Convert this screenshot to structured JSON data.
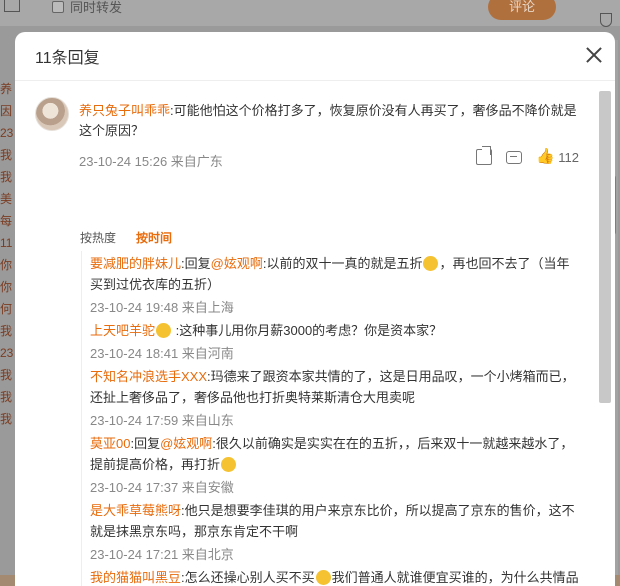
{
  "background": {
    "repost_checkbox_label": "同时转发",
    "comment_button_label": "评论",
    "left_column_chars": [
      "养",
      "因",
      "23",
      "我",
      "我",
      "美",
      "每",
      "11",
      "你",
      "你",
      "何",
      "我",
      "23",
      "我",
      "我",
      "我"
    ]
  },
  "modal": {
    "title": "11条回复",
    "root_comment": {
      "username": "养只兔子叫乖乖",
      "text": ":可能他怕这个价格打多了，恢复原价没有人再买了，奢侈品不降价就是这个原因？",
      "meta": "23-10-24 15:26 来自广东",
      "like_count": "112"
    },
    "sort_options": [
      "按热度",
      "按时间"
    ],
    "replies": [
      {
        "username": "要减肥的胖妹儿",
        "body_a": ":回复",
        "mention": "@妶观啊",
        "body_b": ":以前的双十一真的就是五折",
        "emoji": true,
        "body_c": "，再也回不去了（当年买到过优衣库的五折）",
        "time": "23-10-24 19:48 来自上海"
      },
      {
        "username": "上天吧羊驼",
        "body_a": " ",
        "mention": "",
        "body_b": ":这种事儿用你月薪3000的考虑？你是资本家？",
        "emoji": false,
        "body_c": "",
        "time": "23-10-24 18:41 来自河南",
        "badge_emoji": true
      },
      {
        "username": "不知名冲浪选手XXX",
        "body_a": ":玛德来了跟资本家共情的了，这是日用品叹，一个小烤箱而已，还扯上奢侈品了，奢侈品他也打折奥特莱斯清仓大甩卖呢",
        "mention": "",
        "body_b": "",
        "emoji": false,
        "body_c": "",
        "time": "23-10-24 17:59 来自山东"
      },
      {
        "username": "莫亚00",
        "body_a": ":回复",
        "mention": "@妶观啊",
        "body_b": ":很久以前确实是实实在在的五折，，后来双十一就越来越水了，提前提高价格，再打折",
        "emoji": true,
        "body_c": "",
        "time": "23-10-24 17:37 来自安徽"
      },
      {
        "username": "是大乖草莓熊呀",
        "body_a": ":他只是想要李佳琪的用户来京东比价，所以提高了京东的售价，这不就是抹黑京东吗，那京东肯定不干啊",
        "mention": "",
        "body_b": "",
        "emoji": false,
        "body_c": "",
        "time": "23-10-24 17:21 来自北京"
      },
      {
        "username": "我的猫猫叫黑豆",
        "body_a": ":怎么还操心别人买不买",
        "mention": "",
        "body_b": "",
        "emoji": true,
        "body_c": "我们普通人就谁便宜买谁的，为什么共情品牌和平台",
        "time": ""
      }
    ]
  }
}
